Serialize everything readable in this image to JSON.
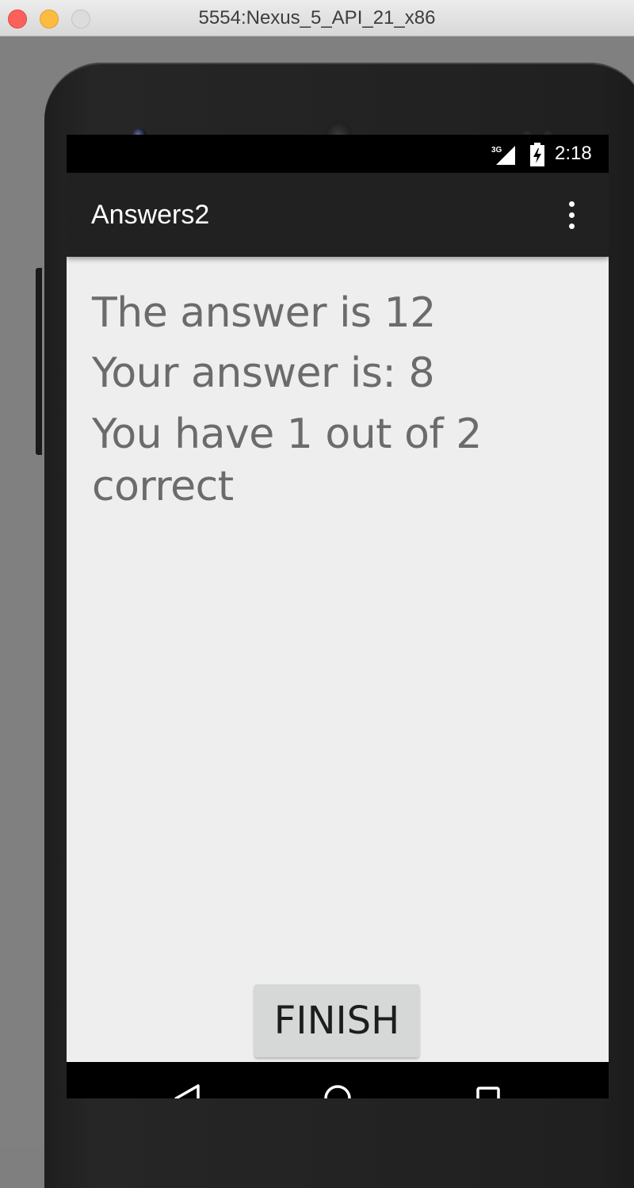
{
  "window": {
    "title": "5554:Nexus_5_API_21_x86"
  },
  "status_bar": {
    "network_label": "3G",
    "time": "2:18",
    "icons": [
      "signal-icon",
      "battery-icon"
    ]
  },
  "app_bar": {
    "title": "Answers2",
    "overflow_icon": "overflow-menu-icon"
  },
  "content": {
    "answer_line": "The answer is 12",
    "your_answer_line": "Your answer is: 8",
    "score_line": "You have 1 out of 2 correct"
  },
  "finish_button": {
    "label": "FINISH"
  },
  "nav_bar": {
    "icons": [
      "back-icon",
      "home-icon",
      "recent-apps-icon"
    ]
  },
  "colors": {
    "app_bar": "#212121",
    "screen_background": "#eeeeee",
    "text": "#6b6b6b",
    "button": "#d6d7d7"
  }
}
